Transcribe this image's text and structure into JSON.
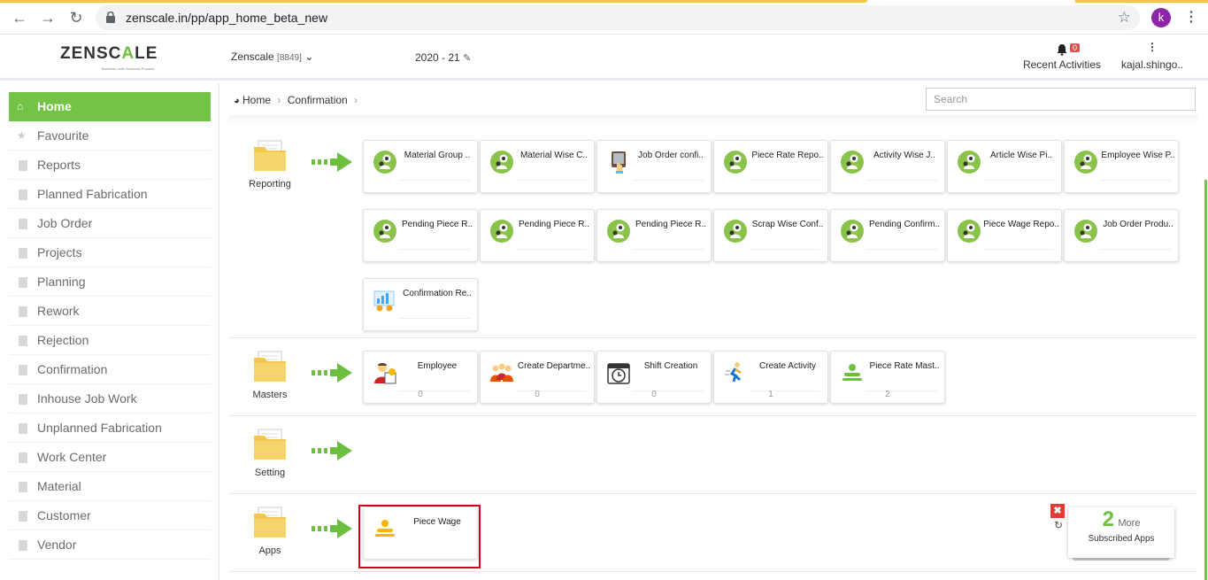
{
  "browser": {
    "url": "zenscale.in/pp/app_home_beta_new",
    "profile_initial": "k"
  },
  "header": {
    "logo_text_a": "ZENSC",
    "logo_text_b": "A",
    "logo_text_c": "LE",
    "logo_tagline": "Business Lean Business Process",
    "company": "Zenscale",
    "company_code": "[8849]",
    "financial_year": "2020 - 21",
    "notification_count": "0",
    "recent_label": "Recent Activities",
    "user_name": "kajal.shingo.."
  },
  "sidebar": {
    "items": [
      {
        "label": "Home"
      },
      {
        "label": "Favourite"
      },
      {
        "label": "Reports"
      },
      {
        "label": "Planned Fabrication"
      },
      {
        "label": "Job Order"
      },
      {
        "label": "Projects"
      },
      {
        "label": "Planning"
      },
      {
        "label": "Rework"
      },
      {
        "label": "Rejection"
      },
      {
        "label": "Confirmation"
      },
      {
        "label": "Inhouse Job Work"
      },
      {
        "label": "Unplanned Fabrication"
      },
      {
        "label": "Work Center"
      },
      {
        "label": "Material"
      },
      {
        "label": "Customer"
      },
      {
        "label": "Vendor"
      }
    ]
  },
  "breadcrumb": {
    "home": "Home",
    "current": "Confirmation"
  },
  "search": {
    "placeholder": "Search"
  },
  "sections": {
    "reporting": {
      "label": "Reporting",
      "tiles": [
        {
          "label": "Material Group .."
        },
        {
          "label": "Material Wise C.."
        },
        {
          "label": "Job Order confi.."
        },
        {
          "label": "Piece Rate Repo.."
        },
        {
          "label": "Activity Wise J.."
        },
        {
          "label": "Article Wise Pi.."
        },
        {
          "label": "Employee Wise P.."
        },
        {
          "label": "Pending Piece R.."
        },
        {
          "label": "Pending Piece R.."
        },
        {
          "label": "Pending Piece R.."
        },
        {
          "label": "Scrap Wise Conf.."
        },
        {
          "label": "Pending Confirm.."
        },
        {
          "label": "Piece Wage Repo.."
        },
        {
          "label": "Job Order Produ.."
        },
        {
          "label": "Confirmation Re.."
        }
      ]
    },
    "masters": {
      "label": "Masters",
      "tiles": [
        {
          "label": "Employee",
          "count": "0"
        },
        {
          "label": "Create Departme..",
          "count": "0"
        },
        {
          "label": "Shift Creation",
          "count": "0"
        },
        {
          "label": "Create Activity",
          "count": "1"
        },
        {
          "label": "Piece Rate Mast..",
          "count": "2"
        }
      ]
    },
    "setting": {
      "label": "Setting"
    },
    "apps": {
      "label": "Apps",
      "tiles": [
        {
          "label": "Piece Wage"
        }
      ]
    }
  },
  "more_apps": {
    "count": "2",
    "more_label": "More",
    "subscribed_label": "Subscribed Apps"
  },
  "colors": {
    "accent": "#72c346",
    "highlight": "#d0021b"
  }
}
